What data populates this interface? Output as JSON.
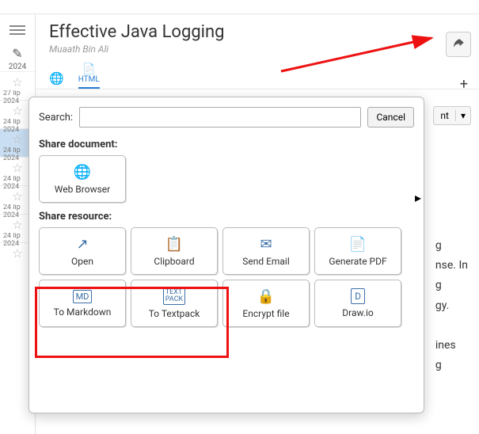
{
  "doc": {
    "title": "Effective Java Logging",
    "author": "Muaath Bin Ali"
  },
  "tabs": {
    "www": "",
    "html": "HTML"
  },
  "toolbar": {
    "nt": "nt",
    "plus": "+"
  },
  "sidebar": {
    "year": "2024",
    "items": [
      {
        "d": "27 lip",
        "y": "2024"
      },
      {
        "d": "24 lip",
        "y": "2024"
      },
      {
        "d": "24 lip",
        "y": "2024"
      },
      {
        "d": "24 lip",
        "y": "2024"
      },
      {
        "d": "24 lip",
        "y": "2024"
      },
      {
        "d": "24 lip",
        "y": "2024"
      }
    ]
  },
  "dialog": {
    "searchLabel": "Search:",
    "searchValue": "",
    "cancel": "Cancel",
    "shareDoc": "Share document:",
    "shareRes": "Share resource:",
    "tiles": {
      "webbrowser": "Web Browser",
      "open": "Open",
      "clipboard": "Clipboard",
      "sendemail": "Send Email",
      "genpdf": "Generate PDF",
      "tomd": "To Markdown",
      "totp": "To Textpack",
      "encrypt": "Encrypt file",
      "drawio": "Draw.io"
    }
  },
  "bg": {
    "l1": "g",
    "l2": "nse. In",
    "l3": "g",
    "l4": "gy.",
    "l5": "ines",
    "l6": "g"
  }
}
